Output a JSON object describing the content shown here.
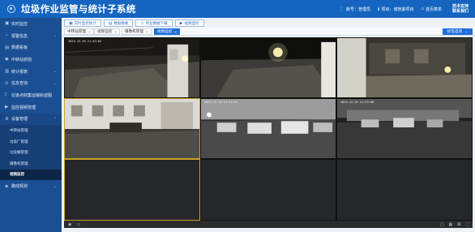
{
  "header": {
    "title": "垃圾作业监管与统计子系统",
    "account": "账号：管理员",
    "project": "项目：城管委项目",
    "home": "首页菜单",
    "support_line1": "技术支持",
    "support_line2": "联系我们"
  },
  "sidebar": {
    "items": [
      {
        "label": "实时监控",
        "icon": "monitor-icon"
      },
      {
        "label": "报警信息",
        "icon": "bell-icon"
      },
      {
        "label": "数据看板",
        "icon": "dashboard-icon"
      },
      {
        "label": "中转站抓拍",
        "icon": "camera-icon"
      },
      {
        "label": "统计报表",
        "icon": "chart-icon"
      },
      {
        "label": "信息查询",
        "icon": "search-icon"
      },
      {
        "label": "垃圾点收集运输轨迹图",
        "icon": "route-icon"
      },
      {
        "label": "监控视频管理",
        "icon": "video-icon"
      },
      {
        "label": "设备管理",
        "icon": "device-icon"
      }
    ],
    "sub_items": [
      {
        "label": "中转站管理"
      },
      {
        "label": "垃圾厂管理"
      },
      {
        "label": "垃圾桶管理"
      },
      {
        "label": "摄像机管理"
      },
      {
        "label": "视频监控"
      }
    ],
    "last_item": {
      "label": "路线规划",
      "icon": "map-icon"
    }
  },
  "toolbar": {
    "buttons": [
      {
        "label": "实时监控统计"
      },
      {
        "label": "数据看板"
      },
      {
        "label": "作业数据下载"
      },
      {
        "label": "视频监控"
      }
    ]
  },
  "tabs": [
    {
      "label": "中转站管理"
    },
    {
      "label": "视频监控"
    },
    {
      "label": "摄像机管理"
    },
    {
      "label": "视频监控"
    }
  ],
  "close_menu": "标签选项",
  "cameras": [
    {
      "timestamp": "2023-12-26  21:43:02"
    },
    {
      "timestamp": ""
    },
    {
      "timestamp": ""
    },
    {
      "timestamp": ""
    },
    {
      "timestamp": "2023-12-26  21:42:55"
    },
    {
      "timestamp": "2023-12-26  21:43:08"
    }
  ],
  "colors": {
    "header": "#1565c0",
    "sidebar": "#1b4f93",
    "accent": "#1e6fd9",
    "selected_cell": "#c9a227"
  }
}
